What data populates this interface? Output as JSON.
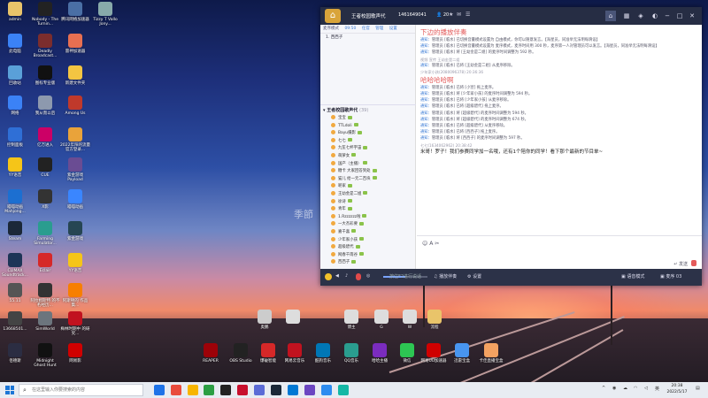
{
  "desktop": {
    "watermark": "季節",
    "icons": [
      {
        "label": "admin",
        "color": "#e9c46a"
      },
      {
        "label": "Nobody - The Turnin...",
        "color": "#222"
      },
      {
        "label": "腾讯网络加速器",
        "color": "#4a6fa5"
      },
      {
        "label": "Tizzy T Vallo Jony...",
        "color": "#8aa"
      },
      {
        "label": "此电脑",
        "color": "#3b82f6"
      },
      {
        "label": "Deadly Broadcast...",
        "color": "#7b2d2d"
      },
      {
        "label": "雷神加速器",
        "color": "#e76f51"
      },
      {
        "label": "回收站",
        "color": "#5aa0d8"
      },
      {
        "label": "图标专业版",
        "color": "#111"
      },
      {
        "label": "新建文件夹",
        "color": "#f4c542"
      },
      {
        "label": "网络",
        "color": "#3b82f6"
      },
      {
        "label": "我从而以后",
        "color": "#8d99ae"
      },
      {
        "label": "Among Us",
        "color": "#c0392b"
      },
      {
        "label": "控制面板",
        "color": "#2f6fd6"
      },
      {
        "label": "亿万进入",
        "color": "#c06"
      },
      {
        "label": "2022年阳的流量 官方登录...",
        "color": "#e9a33a"
      },
      {
        "label": "YY语音",
        "color": "#f5c518"
      },
      {
        "label": "CUE",
        "color": "#222"
      },
      {
        "label": "紫金游戏 Payload",
        "color": "#6a4c93"
      },
      {
        "label": "喵喵动画 Mahjong...",
        "color": "#1c6fd1"
      },
      {
        "label": "X影",
        "color": "#333"
      },
      {
        "label": "喵喵动画",
        "color": "#3a86ff"
      },
      {
        "label": "Steam",
        "color": "#1b2838"
      },
      {
        "label": "Farming Simulator...",
        "color": "#2a9d8f"
      },
      {
        "label": "紫金游戏",
        "color": "#264653"
      },
      {
        "label": "CLIMAX Soundtrack...",
        "color": "#1d3557"
      },
      {
        "label": "Eclair",
        "color": "#d62828"
      },
      {
        "label": "YY语音",
        "color": "#f5c518"
      },
      {
        "label": "55.11",
        "color": "#555"
      },
      {
        "label": "阿拉姆斯特 的不朽经历...",
        "color": "#333"
      },
      {
        "label": "阿斯顿的 作品集...",
        "color": "#f77f00"
      },
      {
        "label": "13668501...",
        "color": "#444"
      },
      {
        "label": "SimWorld",
        "color": "#6c757d"
      },
      {
        "label": "梅林时期中 的研究...",
        "color": "#c1121f"
      },
      {
        "label": "佰德斯",
        "color": "#2b2d42"
      },
      {
        "label": "Midnight Ghost Hunt",
        "color": "#111"
      },
      {
        "label": "网易影",
        "color": "#d00000"
      },
      {
        "label": "奥鹏",
        "color": "#ccc"
      },
      {
        "label": "",
        "color": "#ddd"
      },
      {
        "label": "博主",
        "color": "#ddd"
      },
      {
        "label": "G",
        "color": "#ddd"
      },
      {
        "label": "W",
        "color": "#ddd"
      },
      {
        "label": "流程",
        "color": "#e9c46a"
      },
      {
        "label": "REAPER",
        "color": "#9d0208"
      },
      {
        "label": "OBS Studio",
        "color": "#222"
      },
      {
        "label": "爆破智能",
        "color": "#d62828"
      },
      {
        "label": "网易云音乐",
        "color": "#c1121f"
      },
      {
        "label": "酷狗音乐",
        "color": "#0077b6"
      },
      {
        "label": "QQ音乐",
        "color": "#2a9d8f"
      },
      {
        "label": "哈哈主播",
        "color": "#7b2cbf"
      },
      {
        "label": "微信",
        "color": "#2dc653"
      },
      {
        "label": "网易UU加速器",
        "color": "#d00000"
      },
      {
        "label": "迅雷宝盒",
        "color": "#4895ef"
      },
      {
        "label": "卡佳直播宝盒",
        "color": "#f4a261"
      }
    ]
  },
  "window": {
    "room_name": "王者校园歌声代",
    "room_id": "1461649041",
    "online": "20",
    "left_panel": {
      "tabs": [
        "麦序模式",
        "09:50",
        "任官",
        "管理",
        "设置"
      ],
      "queue": [
        "1. 西西子"
      ],
      "channel_title": "王者校园歌声代",
      "channel_count": "(39)",
      "users": [
        "宝宝",
        "TTLdoli",
        "Bayu摄影",
        "七七",
        "九笙七杯宇宙",
        "萌萝女",
        "国产（主播）",
        "糖卡 大家回答到处",
        "猫儿 给一元二百块",
        "呢家",
        "王幼金是二姐",
        "徐诗",
        "青年",
        "1.Rzzzzzz啦",
        "一大杰彩要",
        "嘉千喜",
        "少年家小孩",
        "超级碧代",
        "网春千雨谷",
        "西西子"
      ]
    },
    "chat": [
      {
        "kind": "big",
        "text": "下边的播放伴奏"
      },
      {
        "kind": "line",
        "tag": "通知：",
        "text": "管理员 [临水] 已切换音量模式设置为 自由模式，你可以随意发言。【海星员，同准举无法明每滑设】"
      },
      {
        "kind": "line",
        "tag": "通知：",
        "text": "管理员 [临水] 已切换音量模式设置为 麦序模式，麦序时间用 300 秒，麦序第一人对管理员可以发言。【海星员，同准举无法明每滑设】"
      },
      {
        "kind": "line",
        "tag": "通知：",
        "text": "管理员 [临水] 将 [王幼金是二姐] 的麦序时间调整为 592 秒。"
      },
      {
        "kind": "meta",
        "text": "视频 宣传 王幼金是二姐"
      },
      {
        "kind": "line",
        "tag": "通知：",
        "text": "管理员 [临水] 已将 [王幼金是二姐] 从麦序移除。"
      },
      {
        "kind": "meta",
        "text": "少年家小孩(2080096378)  20:36:36"
      },
      {
        "kind": "big",
        "text": "哈哈哈哈啊"
      },
      {
        "kind": "line",
        "tag": "通知：",
        "text": "管理员 [临水] 已将 [小宣] 拖上麦序。"
      },
      {
        "kind": "line",
        "tag": "通知：",
        "text": "管理员 [临水] 将 [少年家小孩] 的麦序时间调整为 594 秒。"
      },
      {
        "kind": "line",
        "tag": "通知：",
        "text": "管理员 [临水] 已将 [少年家小孩] 从麦序移除。"
      },
      {
        "kind": "line",
        "tag": "通知：",
        "text": "管理员 [临水] 已将 [超级碧代] 拖上麦序。"
      },
      {
        "kind": "line",
        "tag": "通知：",
        "text": "管理员 [临水] 将 [超级碧代] 的麦序时间调整为 594 秒。"
      },
      {
        "kind": "line",
        "tag": "通知：",
        "text": "管理员 [临水] 将 [超级碧代] 的麦序时间调整为 674 秒。"
      },
      {
        "kind": "line",
        "tag": "通知：",
        "text": "管理员 [临水] 已将 [超级碧代] 从麦序移除。"
      },
      {
        "kind": "line",
        "tag": "通知：",
        "text": "管理员 [临水] 已将 [西西子] 拖上麦序。"
      },
      {
        "kind": "line",
        "tag": "通知：",
        "text": "管理员 [临水] 将 [西西子] 的麦序时间调整为 597 秒。"
      },
      {
        "kind": "meta",
        "text": "七七(1634062962)  20:38:42"
      },
      {
        "kind": "msg",
        "text": "米哥！罗子！我们参赛同学加一名哦，还有1个陪你的同学！看下那个最新的节目单~"
      }
    ],
    "bottom": {
      "music_label": "播放伴奏",
      "settings_label": "设置",
      "recording_hint": "按住F2进行说话",
      "mode_label": "语音模式",
      "queue_label": "麦序 03"
    },
    "inputbar": {
      "send_label": "发送",
      "placeholder": ""
    }
  },
  "taskbar": {
    "search_placeholder": "在这里输入你要搜索的内容",
    "time": "20:38",
    "date": "2022/5/17",
    "icons": [
      "#1e73e8",
      "#e94b3c",
      "#f7b500",
      "#2b9e43",
      "#222",
      "#c8102e",
      "#5b6bd6",
      "#1b2838",
      "#0078d4",
      "#6b46c1",
      "#2d8cf0",
      "#14b8a6"
    ]
  }
}
